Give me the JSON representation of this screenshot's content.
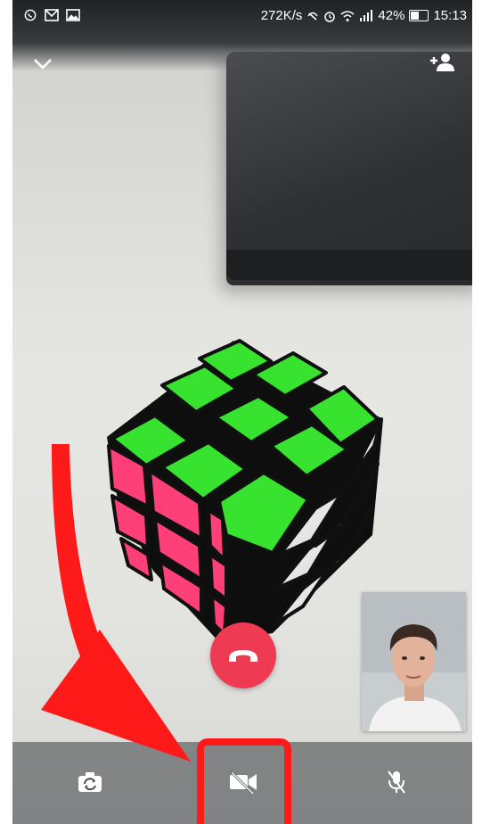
{
  "status_bar": {
    "left_icons": [
      "whatsapp-icon",
      "gmail-icon",
      "gallery-icon"
    ],
    "network_speed": "272K/s",
    "icons": [
      "mute-icon",
      "alarm-icon",
      "wifi-icon",
      "signal-icon"
    ],
    "battery_percent": "42%",
    "battery_level": 0.42,
    "time": "15:13"
  },
  "call": {
    "top_left_icon": "chevron-down-icon",
    "top_right_icon": "add-participant-icon",
    "end_call_icon": "end-call-icon",
    "controls": [
      "switch-camera-icon",
      "video-off-icon",
      "mic-off-icon"
    ]
  },
  "colors": {
    "end_call": "#ef3a54",
    "annotation_red": "#ff1a1a",
    "cube_green": "#38e32f",
    "cube_pink": "#ff3f78"
  }
}
